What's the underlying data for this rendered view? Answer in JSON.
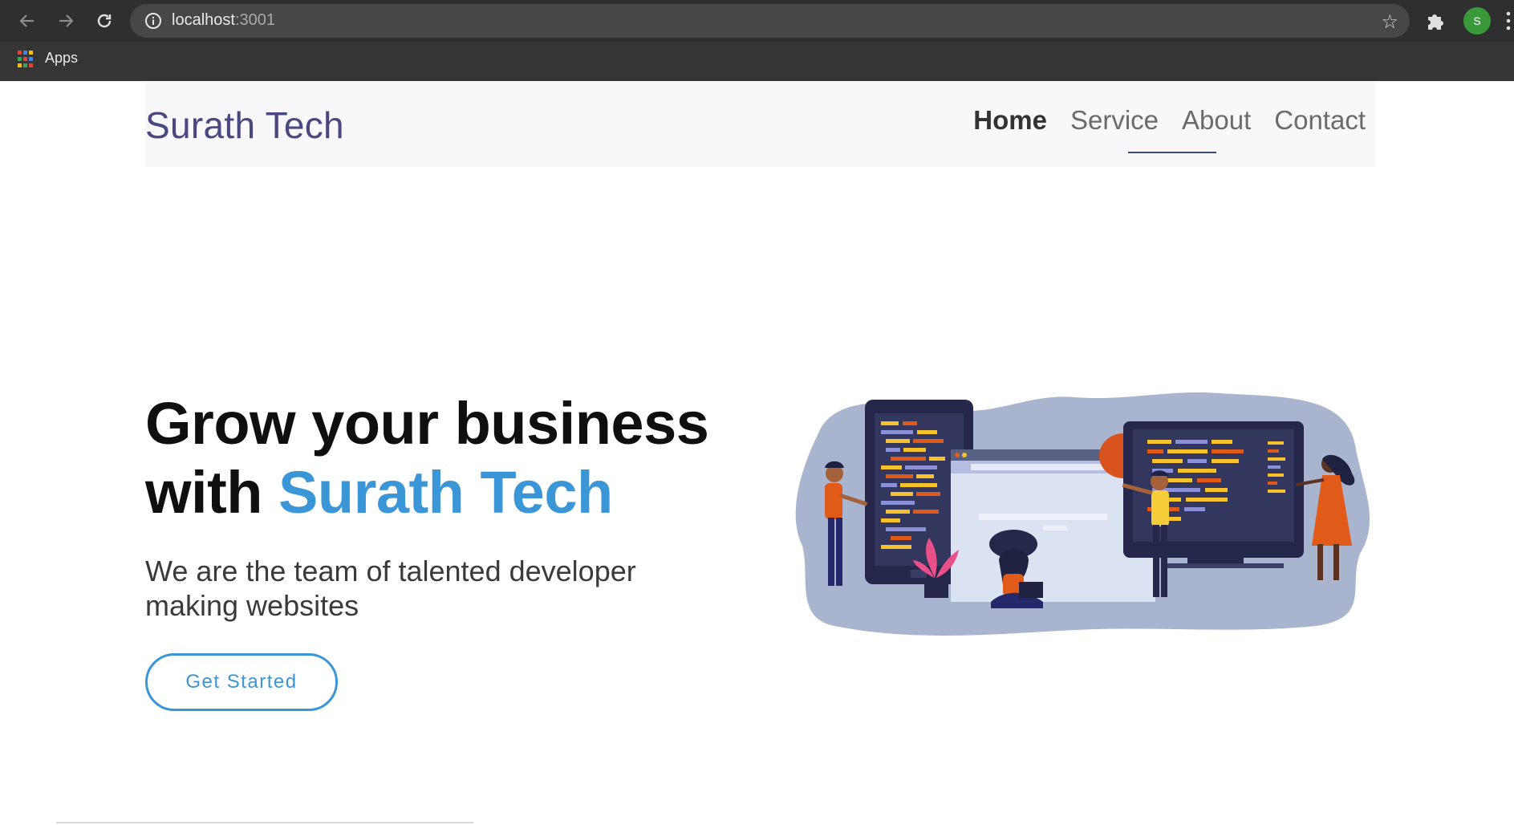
{
  "browser": {
    "url_host": "localhost",
    "url_port": ":3001",
    "avatar_letter": "S",
    "bookmarks": [
      {
        "label": "Apps"
      }
    ]
  },
  "navbar": {
    "brand": "Surath Tech",
    "links": [
      {
        "label": "Home",
        "active": true
      },
      {
        "label": "Service",
        "active": false
      },
      {
        "label": "About",
        "active": false
      },
      {
        "label": "Contact",
        "active": false
      }
    ]
  },
  "hero": {
    "title_line1": "Grow your business",
    "title_line2_prefix": "with ",
    "title_line2_accent": "Surath Tech",
    "subtitle": "We are the team of talented developer making websites",
    "cta_label": "Get Started"
  },
  "colors": {
    "accent": "#3a96d6",
    "brand": "#4a4880",
    "blob": "#a9b4cf"
  },
  "icons": {
    "back": "arrow-left-icon",
    "forward": "arrow-right-icon",
    "reload": "reload-icon",
    "info": "info-icon",
    "bookmark": "star-icon",
    "extensions": "puzzle-icon",
    "apps": "apps-grid-icon",
    "menu": "kebab-menu-icon"
  }
}
